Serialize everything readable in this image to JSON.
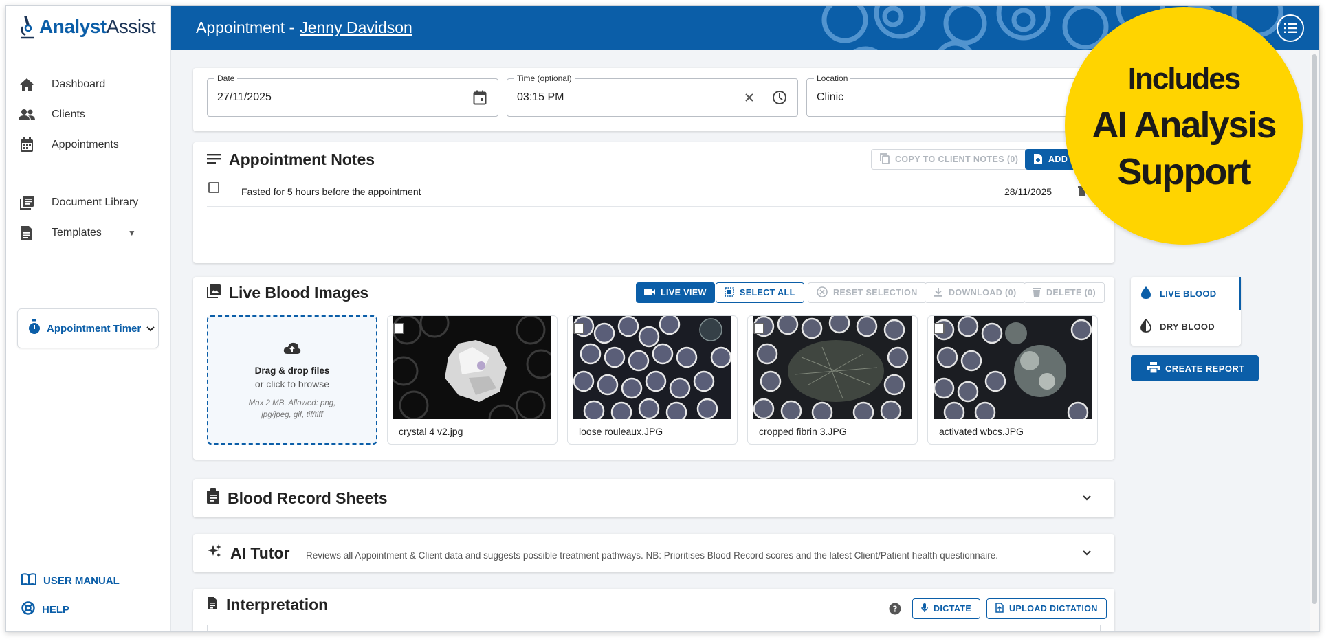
{
  "app": {
    "logo_bold": "Analyst",
    "logo_regular": "Assist"
  },
  "sidebar": {
    "items": [
      {
        "label": "Dashboard",
        "icon": "home-icon"
      },
      {
        "label": "Clients",
        "icon": "people-icon"
      },
      {
        "label": "Appointments",
        "icon": "calendar-icon"
      },
      {
        "label": "Document Library",
        "icon": "library-icon"
      },
      {
        "label": "Templates",
        "icon": "document-icon"
      }
    ],
    "timer_label": "Appointment Timer",
    "user_manual": "USER MANUAL",
    "help": "HELP"
  },
  "header": {
    "prefix": "Appointment -",
    "client_name": "Jenny Davidson"
  },
  "details": {
    "date_label": "Date",
    "date_value": "27/11/2025",
    "time_label": "Time (optional)",
    "time_value": "03:15 PM",
    "location_label": "Location",
    "location_value": "Clinic"
  },
  "notes": {
    "title": "Appointment Notes",
    "copy_button": "COPY TO CLIENT NOTES (0)",
    "add_button": "ADD N",
    "rows": [
      {
        "text": "Fasted for 5 hours before the appointment",
        "date": "28/11/2025"
      }
    ]
  },
  "images": {
    "title": "Live Blood Images",
    "buttons": {
      "live_view": "LIVE VIEW",
      "select_all": "SELECT ALL",
      "reset": "RESET SELECTION",
      "download": "DOWNLOAD (0)",
      "delete": "DELETE (0)"
    },
    "dropzone": {
      "title": "Drag & drop files",
      "subtitle": "or click to browse",
      "hint": "Max 2 MB. Allowed: png, jpg/jpeg, gif, tif/tiff"
    },
    "files": [
      {
        "name": "crystal 4 v2.jpg"
      },
      {
        "name": "loose rouleaux.JPG"
      },
      {
        "name": "cropped fibrin 3.JPG"
      },
      {
        "name": "activated wbcs.JPG"
      }
    ]
  },
  "blood_record": {
    "title": "Blood Record Sheets"
  },
  "ai_tutor": {
    "title": "AI Tutor",
    "description": "Reviews all Appointment & Client data and suggests possible treatment pathways. NB: Prioritises Blood Record scores and the latest Client/Patient health questionnaire."
  },
  "interpretation": {
    "title": "Interpretation",
    "dictate": "DICTATE",
    "upload_dictation": "UPLOAD DICTATION"
  },
  "right_rail": {
    "tab_live": "LIVE BLOOD",
    "tab_dry": "DRY BLOOD",
    "create_report": "CREATE REPORT"
  },
  "badge": {
    "line1": "Includes",
    "line2": "AI Analysis",
    "line3": "Support"
  },
  "colors": {
    "primary": "#0b5ea8",
    "badge": "#ffd400",
    "background": "#f2f4f7"
  }
}
